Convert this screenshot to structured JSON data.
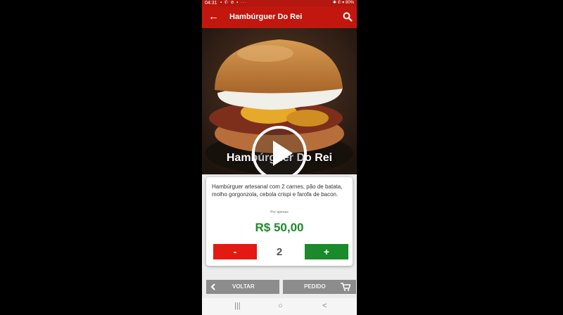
{
  "status_bar": {
    "time": "04:31",
    "icons": "▪ ✆ ⊘ ▪ ···",
    "right": "✱ ✆ ▾ 80%"
  },
  "app_bar": {
    "title": "Hambúrguer Do Rei",
    "back_icon": "arrow-left-icon",
    "search_icon": "search-icon"
  },
  "hero": {
    "product_name": "Hambúrguer Do Rei"
  },
  "product": {
    "description": "Hambúrguer artesanal com 2 carnes, pão de batata, molho gorgonzola, cebola crispi e farofa de bacon.",
    "price_label": "Por apenas",
    "price": "R$ 50,00",
    "quantity": "2",
    "minus_label": "-",
    "plus_label": "+"
  },
  "actions": {
    "back_label": "VOLTAR",
    "order_label": "PEDIDO"
  },
  "nav": {
    "recents": "|||",
    "home": "○",
    "back": "<"
  },
  "colors": {
    "primary": "#c1170f",
    "price": "#1e8a2c",
    "minus": "#e21a12",
    "plus": "#1a8a2a",
    "action": "#8c8c8c"
  }
}
